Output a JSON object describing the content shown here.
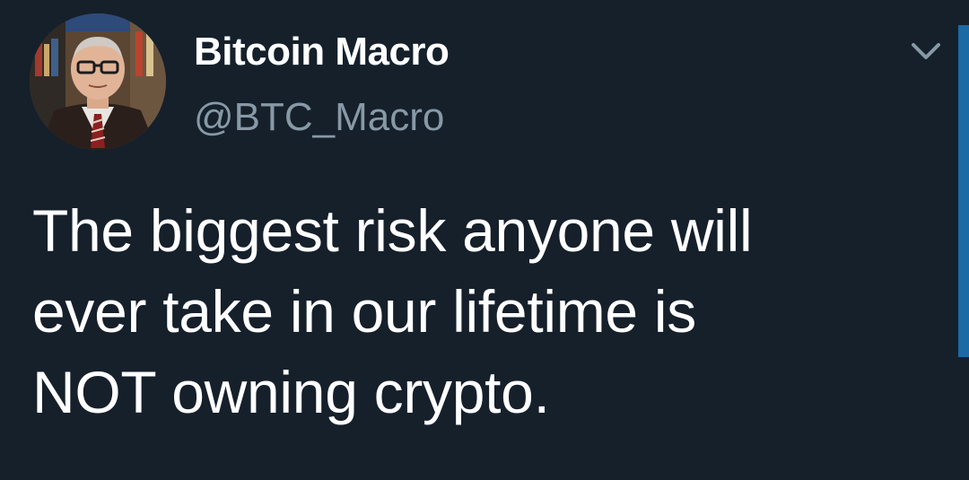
{
  "author": {
    "display_name": "Bitcoin Macro",
    "handle": "@BTC_Macro",
    "avatar_icon": "profile-photo"
  },
  "tweet": {
    "lines": [
      "The biggest risk anyone will",
      "ever take in our lifetime is",
      "NOT owning crypto."
    ]
  },
  "menu": {
    "icon": "chevron-down-icon"
  },
  "colors": {
    "background": "#15202b",
    "name": "#ffffff",
    "handle": "#8899a6",
    "text": "#ffffff",
    "chevron": "#8899a6",
    "side_bar": "#1b6aa6"
  }
}
